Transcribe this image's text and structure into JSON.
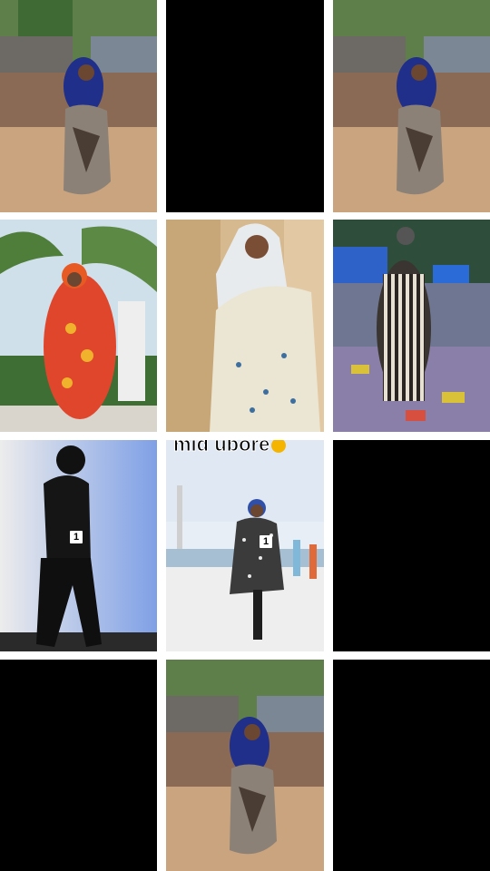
{
  "grid": {
    "tiles": [
      {
        "id": "r1c1",
        "kind": "photo",
        "scene": "street-woman-blue-hijab"
      },
      {
        "id": "r1c2",
        "kind": "black"
      },
      {
        "id": "r1c3",
        "kind": "photo",
        "scene": "street-woman-blue-hijab"
      },
      {
        "id": "r2c1",
        "kind": "photo",
        "scene": "palm-woman-red-dress"
      },
      {
        "id": "r2c2",
        "kind": "photo",
        "scene": "room-woman-white-hijab"
      },
      {
        "id": "r2c3",
        "kind": "photo",
        "scene": "plaza-woman-striped-dress"
      },
      {
        "id": "r3c1",
        "kind": "photo",
        "scene": "studio-woman-black-outfit",
        "badge": "1"
      },
      {
        "id": "r3c2",
        "kind": "photo",
        "scene": "beach-woman-leopard-dress",
        "badge": "1",
        "caption": "mid ubore"
      },
      {
        "id": "r3c3",
        "kind": "black"
      },
      {
        "id": "r4c1",
        "kind": "black"
      },
      {
        "id": "r4c2",
        "kind": "photo",
        "scene": "street-woman-blue-hijab"
      },
      {
        "id": "r4c3",
        "kind": "black"
      }
    ]
  },
  "colors": {
    "gutter": "#ffffff",
    "empty_tile": "#000000"
  }
}
